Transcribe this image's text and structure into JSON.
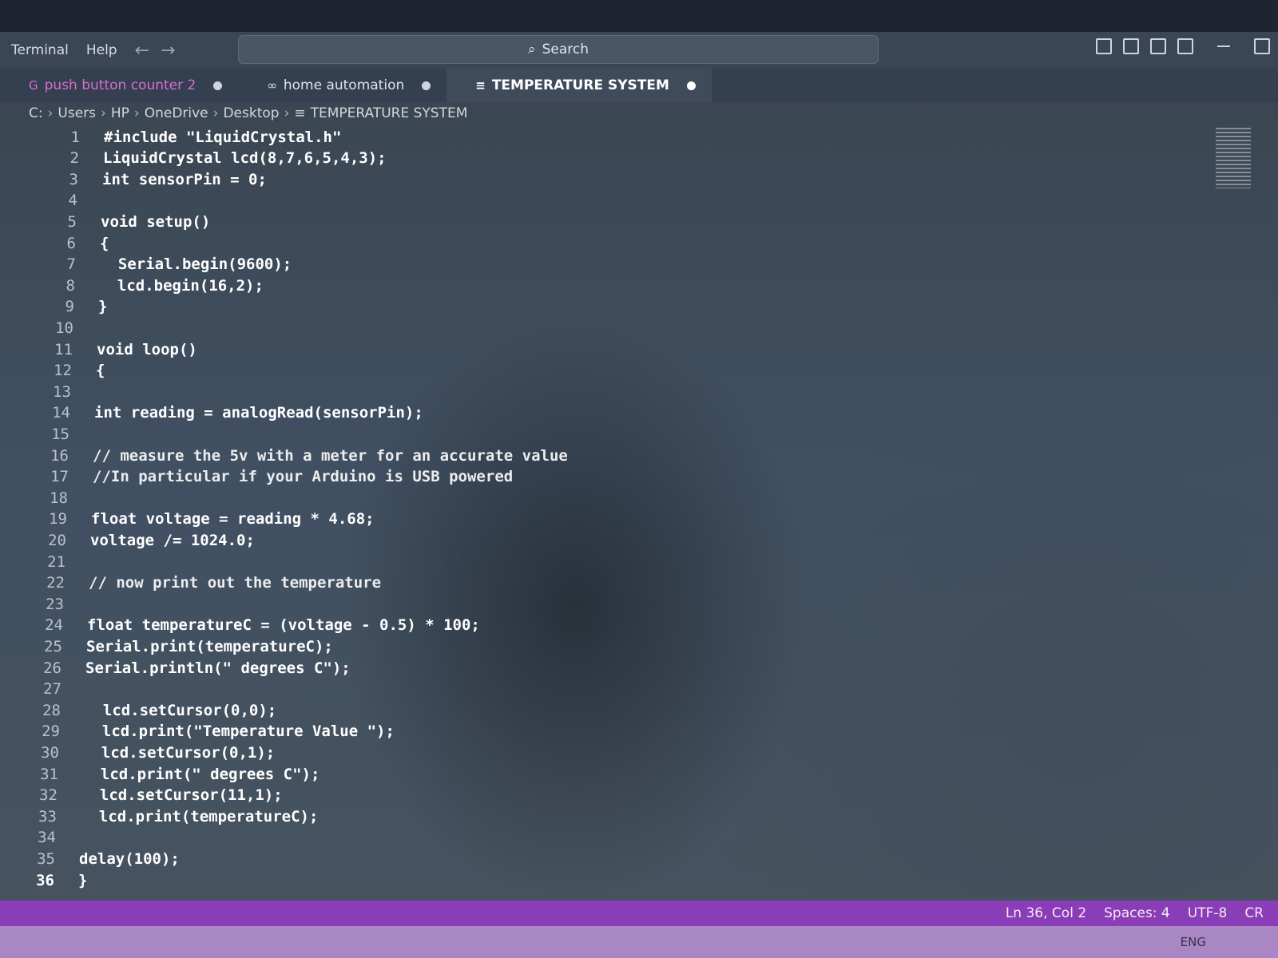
{
  "menu": {
    "items": [
      "Terminal",
      "Help"
    ]
  },
  "search": {
    "label": "Search",
    "icon": "search-icon"
  },
  "tabs": [
    {
      "label": "push button counter 2",
      "icon": "git-icon",
      "modified": true
    },
    {
      "label": "home automation",
      "icon": "arduino-icon",
      "modified": true
    },
    {
      "label": "TEMPERATURE SYSTEM",
      "icon": "file-lines-icon",
      "modified": true,
      "active": true
    }
  ],
  "breadcrumb": [
    "C:",
    "Users",
    "HP",
    "OneDrive",
    "Desktop",
    "TEMPERATURE SYSTEM"
  ],
  "editor": {
    "current_line": 36,
    "lines": [
      {
        "n": "1",
        "indent": "",
        "text": "#include \"LiquidCrystal.h\""
      },
      {
        "n": "2",
        "indent": "",
        "text": "LiquidCrystal lcd(8,7,6,5,4,3);"
      },
      {
        "n": "3",
        "indent": "",
        "text": "int sensorPin = 0;"
      },
      {
        "n": "4",
        "indent": "",
        "text": ""
      },
      {
        "n": "5",
        "indent": "",
        "text": "void setup()"
      },
      {
        "n": "6",
        "indent": "",
        "text": "{"
      },
      {
        "n": "7",
        "indent": "  ",
        "text": "Serial.begin(9600);"
      },
      {
        "n": "8",
        "indent": "  ",
        "text": "lcd.begin(16,2);"
      },
      {
        "n": "9",
        "indent": "",
        "text": "}"
      },
      {
        "n": "10",
        "indent": "",
        "text": ""
      },
      {
        "n": "11",
        "indent": "",
        "text": "void loop()"
      },
      {
        "n": "12",
        "indent": "",
        "text": "{"
      },
      {
        "n": "13",
        "indent": "",
        "text": ""
      },
      {
        "n": "14",
        "indent": "",
        "text": "int reading = analogRead(sensorPin);"
      },
      {
        "n": "15",
        "indent": "",
        "text": ""
      },
      {
        "n": "16",
        "indent": "",
        "text": "// measure the 5v with a meter for an accurate value"
      },
      {
        "n": "17",
        "indent": "",
        "text": "//In particular if your Arduino is USB powered"
      },
      {
        "n": "18",
        "indent": "",
        "text": ""
      },
      {
        "n": "19",
        "indent": "",
        "text": "float voltage = reading * 4.68;"
      },
      {
        "n": "20",
        "indent": "",
        "text": "voltage /= 1024.0;"
      },
      {
        "n": "21",
        "indent": "",
        "text": ""
      },
      {
        "n": "22",
        "indent": "",
        "text": "// now print out the temperature"
      },
      {
        "n": "23",
        "indent": "",
        "text": ""
      },
      {
        "n": "24",
        "indent": "",
        "text": "float temperatureC = (voltage - 0.5) * 100;"
      },
      {
        "n": "25",
        "indent": "",
        "text": "Serial.print(temperatureC);"
      },
      {
        "n": "26",
        "indent": "",
        "text": "Serial.println(\" degrees C\");"
      },
      {
        "n": "27",
        "indent": "",
        "text": ""
      },
      {
        "n": "28",
        "indent": "  ",
        "text": "lcd.setCursor(0,0);"
      },
      {
        "n": "29",
        "indent": "  ",
        "text": "lcd.print(\"Temperature Value \");"
      },
      {
        "n": "30",
        "indent": "  ",
        "text": "lcd.setCursor(0,1);"
      },
      {
        "n": "31",
        "indent": "  ",
        "text": "lcd.print(\" degrees C\");"
      },
      {
        "n": "32",
        "indent": "  ",
        "text": "lcd.setCursor(11,1);"
      },
      {
        "n": "33",
        "indent": "  ",
        "text": "lcd.print(temperatureC);"
      },
      {
        "n": "34",
        "indent": "",
        "text": ""
      },
      {
        "n": "35",
        "indent": "",
        "text": "delay(100);"
      },
      {
        "n": "36",
        "indent": "",
        "text": "}"
      }
    ]
  },
  "status": {
    "position": "Ln 36, Col 2",
    "spaces": "Spaces: 4",
    "encoding": "UTF-8",
    "eol": "CR"
  },
  "taskbar": {
    "lang": "ENG"
  },
  "colors": {
    "statusbar": "#8b3db8",
    "tab_git": "#d96bd0"
  }
}
